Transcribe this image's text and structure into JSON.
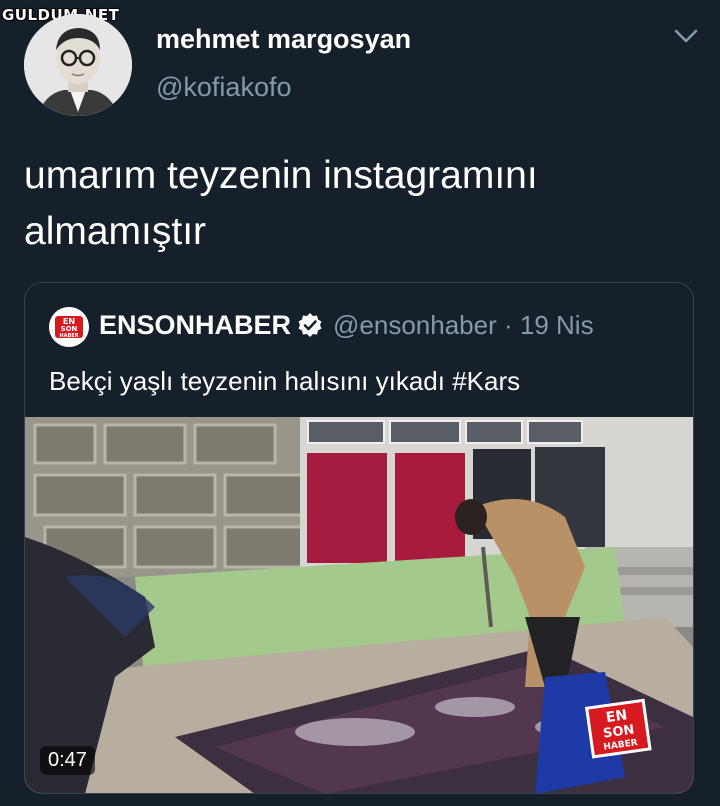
{
  "watermark": "GULDUM.NET",
  "tweet": {
    "display_name": "mehmet margosyan",
    "handle": "@kofiakofo",
    "text_line1": "umarım teyzenin instagramını",
    "text_line2": "almamıştır"
  },
  "quoted": {
    "display_name": "ENSONHABER",
    "handle": "@ensonhaber",
    "date": "19 Nis",
    "separator": "·",
    "text": "Bekçi yaşlı teyzenin halısını yıkadı #Kars",
    "logo_text": [
      "EN",
      "SON",
      "HABER"
    ],
    "video": {
      "duration": "0:47",
      "overlay_logo": [
        "EN",
        "SON",
        "HABER"
      ]
    }
  },
  "icons": {
    "menu": "chevron-down-icon",
    "verified": "verified-badge-icon"
  },
  "colors": {
    "background": "#15202b",
    "secondary_text": "#8899a6",
    "border": "#38444d",
    "brand_red": "#d71920"
  }
}
